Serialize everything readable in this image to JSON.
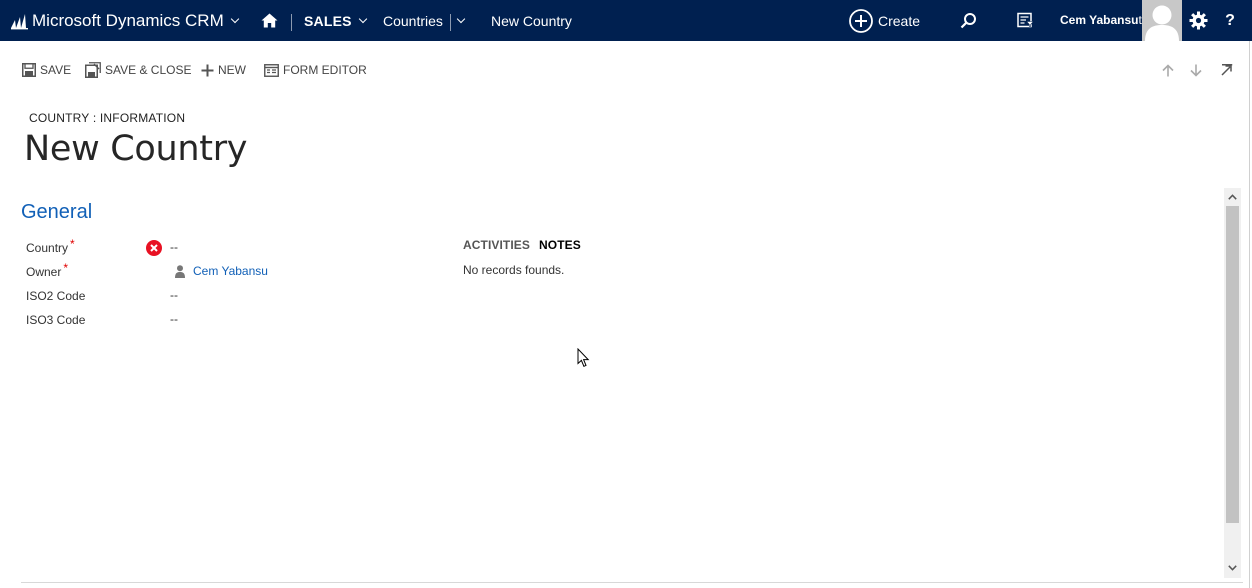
{
  "nav": {
    "app_title": "Microsoft Dynamics CRM",
    "area": "SALES",
    "entity": "Countries",
    "record": "New Country",
    "create_label": "Create",
    "help": "?",
    "user": {
      "name": "Cem Yabansu",
      "org": "temp"
    },
    "bar_color": "#002050"
  },
  "commands": {
    "save": "SAVE",
    "save_close": "SAVE & CLOSE",
    "new": "NEW",
    "form_editor": "FORM EDITOR"
  },
  "header": {
    "entity_form": "COUNTRY : INFORMATION",
    "title": "New Country"
  },
  "section": {
    "title": "General",
    "fields": [
      {
        "label": "Country",
        "required": true,
        "value": "--",
        "status": "error"
      },
      {
        "label": "Owner",
        "required": true,
        "value": "Cem Yabansu",
        "type": "lookup"
      },
      {
        "label": "ISO2 Code",
        "value": "--"
      },
      {
        "label": "ISO3 Code",
        "value": "--"
      }
    ]
  },
  "notes": {
    "tabs": [
      "ACTIVITIES",
      "NOTES"
    ],
    "selected_tab": "NOTES",
    "empty_message": "No records founds."
  },
  "colors": {
    "accent": "#1160b7",
    "required": "#e00000",
    "error": "#e81123"
  }
}
